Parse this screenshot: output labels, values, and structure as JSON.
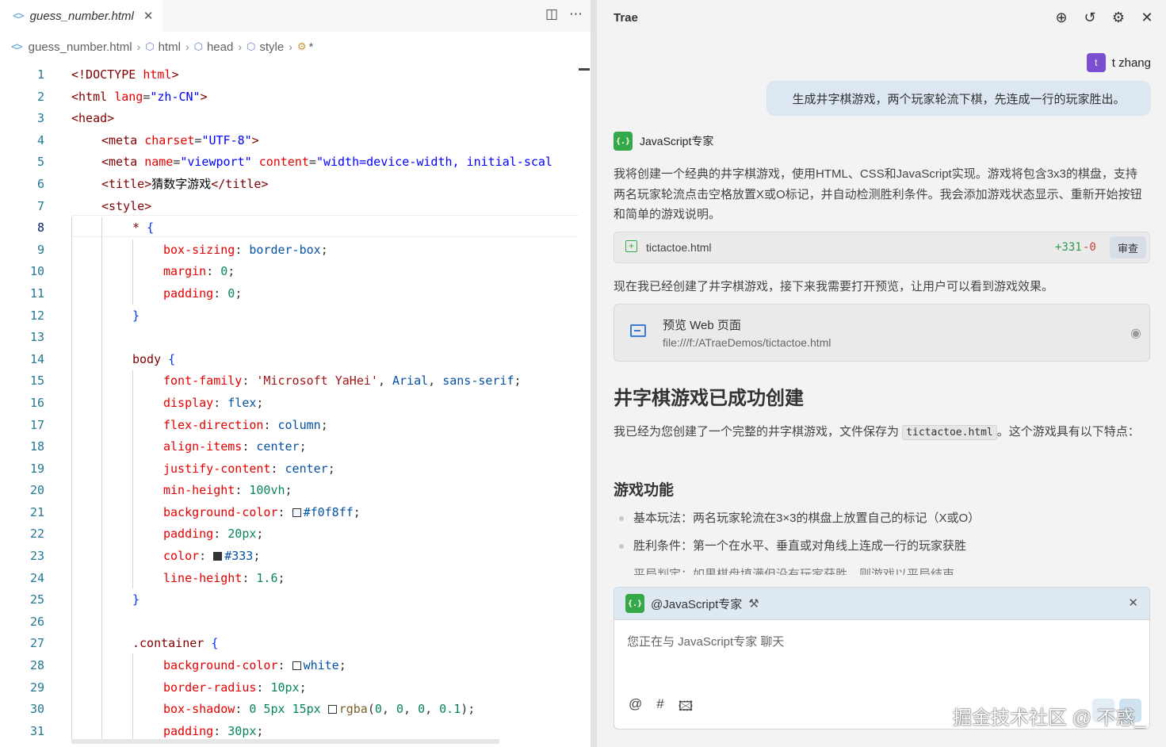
{
  "editor": {
    "tab": {
      "icon": "code-icon",
      "label": "guess_number.html"
    },
    "breadcrumb": {
      "file": "guess_number.html",
      "html": "html",
      "head": "head",
      "style": "style",
      "selector": "*"
    },
    "active_line": 8,
    "lines": [
      {
        "n": "1"
      },
      {
        "n": "2"
      },
      {
        "n": "3"
      },
      {
        "n": "4"
      },
      {
        "n": "5"
      },
      {
        "n": "6"
      },
      {
        "n": "7"
      },
      {
        "n": "8"
      },
      {
        "n": "9"
      },
      {
        "n": "10"
      },
      {
        "n": "11"
      },
      {
        "n": "12"
      },
      {
        "n": "13"
      },
      {
        "n": "14"
      },
      {
        "n": "15"
      },
      {
        "n": "16"
      },
      {
        "n": "17"
      },
      {
        "n": "18"
      },
      {
        "n": "19"
      },
      {
        "n": "20"
      },
      {
        "n": "21"
      },
      {
        "n": "22"
      },
      {
        "n": "23"
      },
      {
        "n": "24"
      },
      {
        "n": "25"
      },
      {
        "n": "26"
      },
      {
        "n": "27"
      },
      {
        "n": "28"
      },
      {
        "n": "29"
      },
      {
        "n": "30"
      },
      {
        "n": "31"
      }
    ],
    "code": {
      "l1": [
        "<!DOCTYPE ",
        "html",
        ">"
      ],
      "l2": [
        "<html ",
        "lang",
        "=",
        "\"zh-CN\"",
        ">"
      ],
      "l3": [
        "<head>"
      ],
      "l4": [
        "<meta ",
        "charset",
        "=",
        "\"UTF-8\"",
        ">"
      ],
      "l5": [
        "<meta ",
        "name",
        "=",
        "\"viewport\"",
        " ",
        "content",
        "=",
        "\"width=device-width, initial-scal"
      ],
      "l6": [
        "<title>",
        "猜数字游戏",
        "</title>"
      ],
      "l7": [
        "<style>"
      ],
      "l8": [
        "* ",
        "{"
      ],
      "l9": [
        "box-sizing",
        ": ",
        "border-box",
        ";"
      ],
      "l10": [
        "margin",
        ": ",
        "0",
        ";"
      ],
      "l11": [
        "padding",
        ": ",
        "0",
        ";"
      ],
      "l12": [
        "}"
      ],
      "l14": [
        "body ",
        "{"
      ],
      "l15": [
        "font-family",
        ": ",
        "'Microsoft YaHei'",
        ", ",
        "Arial",
        ", ",
        "sans-serif",
        ";"
      ],
      "l16": [
        "display",
        ": ",
        "flex",
        ";"
      ],
      "l17": [
        "flex-direction",
        ": ",
        "column",
        ";"
      ],
      "l18": [
        "align-items",
        ": ",
        "center",
        ";"
      ],
      "l19": [
        "justify-content",
        ": ",
        "center",
        ";"
      ],
      "l20": [
        "min-height",
        ": ",
        "100vh",
        ";"
      ],
      "l21": [
        "background-color",
        ": ",
        "#f0f8ff",
        ";"
      ],
      "l22": [
        "padding",
        ": ",
        "20px",
        ";"
      ],
      "l23": [
        "color",
        ": ",
        "#333",
        ";"
      ],
      "l24": [
        "line-height",
        ": ",
        "1.6",
        ";"
      ],
      "l25": [
        "}"
      ],
      "l27": [
        ".container ",
        "{"
      ],
      "l28": [
        "background-color",
        ": ",
        "white",
        ";"
      ],
      "l29": [
        "border-radius",
        ": ",
        "10px",
        ";"
      ],
      "l30": [
        "box-shadow",
        ": ",
        "0 5px 15px ",
        "rgba",
        "(",
        "0",
        ", ",
        "0",
        ", ",
        "0",
        ", ",
        "0.1",
        ");"
      ],
      "l31": [
        "padding",
        ": ",
        "30px",
        ";"
      ]
    },
    "swatches": {
      "l21": "#f0f8ff",
      "l23": "#333333",
      "l28": "#ffffff",
      "l30": "#ffffff"
    }
  },
  "chat": {
    "title": "Trae",
    "header_icons": [
      "new-chat-icon",
      "history-icon",
      "settings-icon",
      "close-icon"
    ],
    "user": {
      "avatar_letter": "t",
      "name": "t zhang"
    },
    "user_message": "生成井字棋游戏，两个玩家轮流下棋，先连成一行的玩家胜出。",
    "agent": {
      "name": "JavaScript专家",
      "logo_text": "{.}"
    },
    "intro": "我将创建一个经典的井字棋游戏，使用HTML、CSS和JavaScript实现。游戏将包含3x3的棋盘，支持两名玩家轮流点击空格放置X或O标记，并自动检测胜利条件。我会添加游戏状态显示、重新开始按钮和简单的游戏说明。",
    "file_card": {
      "file": "tictactoe.html",
      "added": "+331",
      "removed": "-0",
      "review": "审查"
    },
    "status": "现在我已经创建了井字棋游戏，接下来我需要打开预览，让用户可以看到游戏效果。",
    "preview": {
      "title": "预览 Web 页面",
      "path": "file:///f:/ATraeDemos/tictactoe.html"
    },
    "heading": "井字棋游戏已成功创建",
    "para_before": "我已经为您创建了一个完整的井字棋游戏，文件保存为",
    "para_code": "tictactoe.html",
    "para_after": "。这个游戏具有以下特点：",
    "subheading": "游戏功能",
    "features": [
      "基本玩法：两名玩家轮流在3×3的棋盘上放置自己的标记（X或O）",
      "胜利条件：第一个在水平、垂直或对角线上连成一行的玩家获胜"
    ],
    "feature_cut": "平局判定：如果棋盘填满但没有玩家获胜，则游戏以平局结束",
    "input": {
      "mention": "@JavaScript专家",
      "placeholder": "您正在与 JavaScript专家 聊天",
      "tools": [
        "@",
        "#",
        "image-icon"
      ]
    },
    "watermark": "掘金技术社区 @ 不惑_"
  }
}
